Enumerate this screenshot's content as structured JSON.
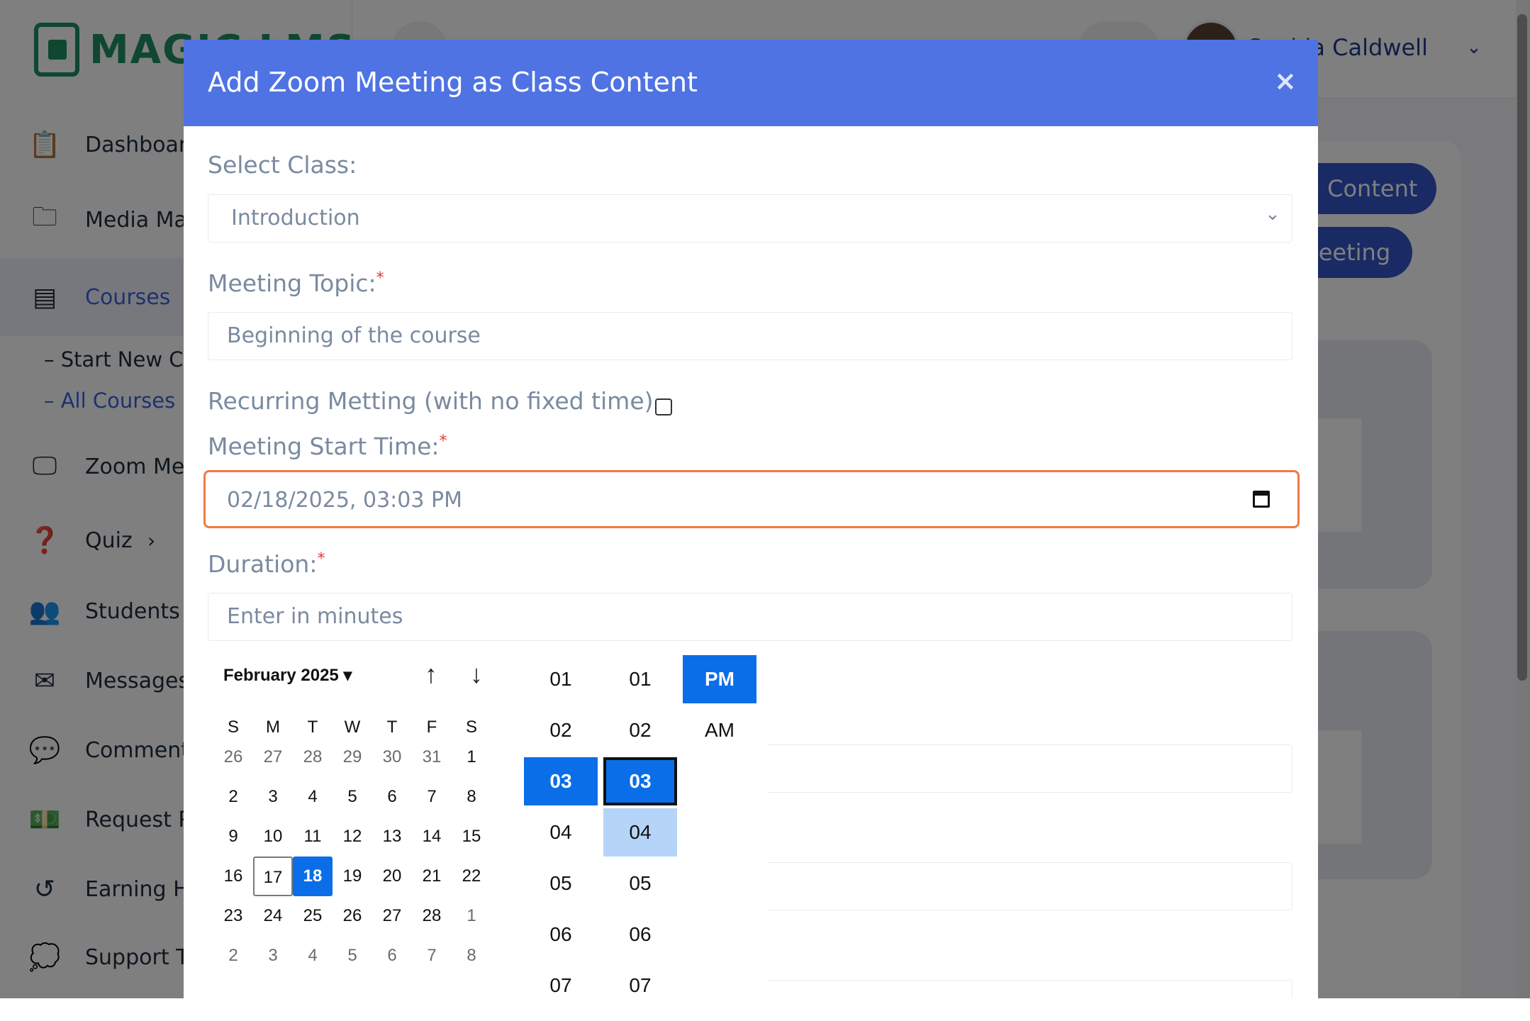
{
  "app": {
    "logo_text": "MAGIC LMS",
    "user_name": "Sophia Caldwell",
    "nav": {
      "dashboard": "Dashboard",
      "media": "Media Manager",
      "courses": "Courses",
      "sub_start": "– Start New Course",
      "sub_all": "– All Courses",
      "zoom": "Zoom Meetings",
      "quiz": "Quiz",
      "students": "Students",
      "messages": "Messages",
      "comments": "Comments",
      "request": "Request Payout",
      "earning": "Earning History",
      "support": "Support Tickets"
    },
    "buttons": {
      "add_content": "Add Content",
      "add_meeting": "Add Meeting"
    }
  },
  "modal": {
    "title": "Add Zoom Meeting as Class Content",
    "close": "×",
    "select_class_label": "Select Class:",
    "select_class_value": "Introduction",
    "topic_label": "Meeting Topic:",
    "topic_value": "Beginning of the course",
    "recurring_label": "Recurring Metting (with no fixed time)",
    "start_label": "Meeting Start Time:",
    "start_value": "02/18/2025, 03:03 PM",
    "duration_label": "Duration:",
    "duration_placeholder": "Enter in minutes",
    "required_mark": "*"
  },
  "picker": {
    "month_label": "February 2025",
    "dow": [
      "S",
      "M",
      "T",
      "W",
      "T",
      "F",
      "S"
    ],
    "weeks": [
      [
        "26",
        "27",
        "28",
        "29",
        "30",
        "31",
        "1"
      ],
      [
        "2",
        "3",
        "4",
        "5",
        "6",
        "7",
        "8"
      ],
      [
        "9",
        "10",
        "11",
        "12",
        "13",
        "14",
        "15"
      ],
      [
        "16",
        "17",
        "18",
        "19",
        "20",
        "21",
        "22"
      ],
      [
        "23",
        "24",
        "25",
        "26",
        "27",
        "28",
        "1"
      ],
      [
        "2",
        "3",
        "4",
        "5",
        "6",
        "7",
        "8"
      ]
    ],
    "hours": [
      "01",
      "02",
      "03",
      "04",
      "05",
      "06",
      "07"
    ],
    "minutes": [
      "01",
      "02",
      "03",
      "04",
      "05",
      "06",
      "07"
    ],
    "ampm": [
      "PM",
      "AM"
    ],
    "selected_hour": "03",
    "selected_minute": "03",
    "selected_ampm": "PM",
    "selected_day": "18",
    "today": "17"
  },
  "colors": {
    "modal_header": "#4f73e3",
    "selected": "#0a6ee8",
    "focus_border": "#f07a41",
    "brand": "#1f8f63"
  }
}
